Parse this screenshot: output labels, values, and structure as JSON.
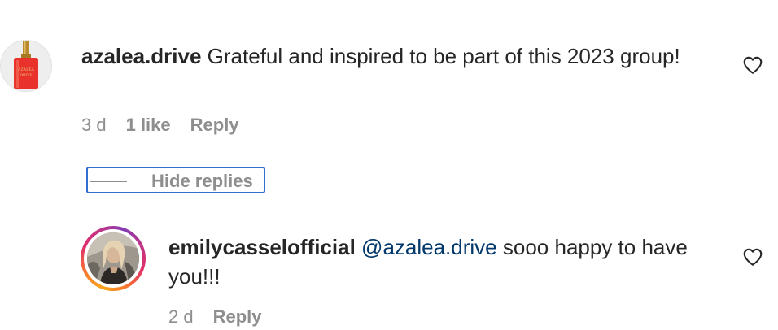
{
  "comments": [
    {
      "username": "azalea.drive",
      "text": "Grateful and inspired to be part of this 2023 group!",
      "time": "3 d",
      "likes": "1 like",
      "reply_label": "Reply",
      "avatar_icon": "nail-polish-bottle-icon",
      "avatar_brand_text": "AZALEA DRIVE"
    },
    {
      "username": "emilycasselofficial",
      "mention": "@azalea.drive",
      "text": "sooo happy to have you!!!",
      "time": "2 d",
      "reply_label": "Reply",
      "avatar_icon": "profile-photo",
      "story_ring": true
    }
  ],
  "hide_replies": {
    "label": "Hide replies"
  },
  "icons": {
    "like": "heart-outline-icon"
  },
  "colors": {
    "text": "#262626",
    "muted": "#8e8e8e",
    "mention": "#00376b",
    "focus_outline": "#2f6fd0",
    "polish_red": "#e8322b"
  }
}
